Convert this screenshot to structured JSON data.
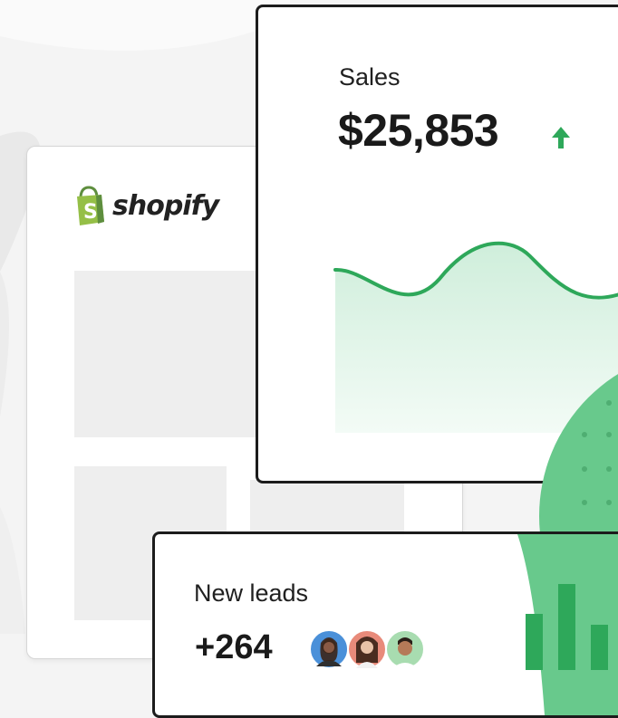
{
  "brand": {
    "name": "shopify",
    "color": "#95bf47"
  },
  "sales_card": {
    "label": "Sales",
    "value": "$25,853",
    "trend_icon": "arrow-up-icon",
    "accent": "#2ea85a"
  },
  "leads_card": {
    "label": "New leads",
    "value": "+264",
    "avatars": [
      "avatar-1",
      "avatar-2",
      "avatar-3"
    ],
    "avatar_colors": [
      "#4a90d9",
      "#e88a7a",
      "#a8dcb0"
    ]
  },
  "decor": {
    "blob_color": "#68c98c"
  }
}
